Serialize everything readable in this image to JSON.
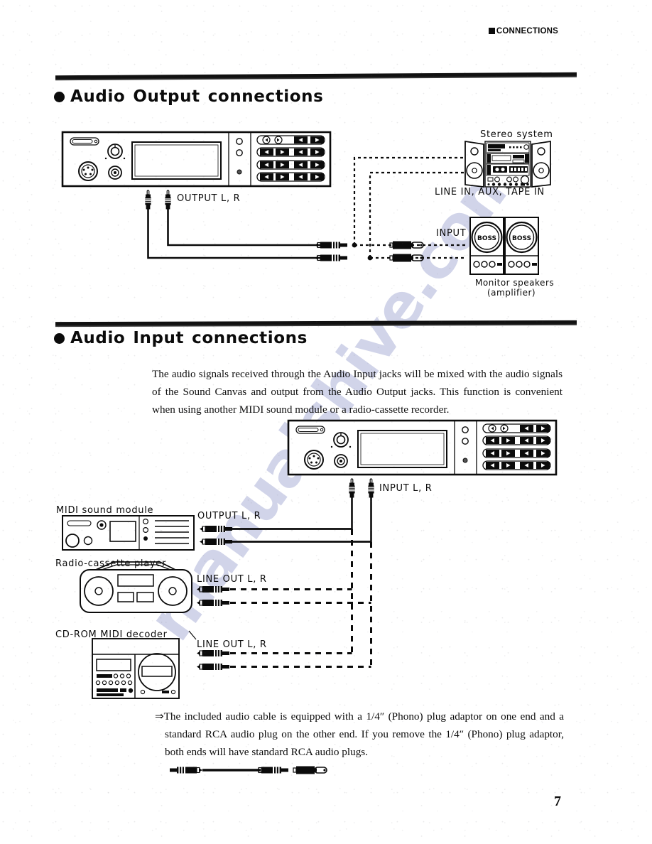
{
  "page": {
    "running_head": "CONNECTIONS",
    "page_number": "7",
    "watermark": "manualshive.com"
  },
  "sections": [
    {
      "id": "audio-output",
      "bullet": "●",
      "words": [
        "Audio",
        "Output",
        "connections"
      ],
      "title": "Audio Output connections"
    },
    {
      "id": "audio-input",
      "bullet": "●",
      "words": [
        "Audio",
        "Input",
        "connections"
      ],
      "title": "Audio Input connections"
    }
  ],
  "intro_paragraph": "The audio signals received through the Audio Input jacks will be mixed with the audio signals of the Sound Canvas and output from the Audio Output jacks. This function is convenient when using another MIDI sound module or a radio-cassette recorder.",
  "footnote": {
    "arrow": "⇒",
    "text": "The included audio cable is equipped with a 1/4″ (Phono) plug adaptor on one end and a standard RCA audio plug on the other end. If you remove the 1/4″ (Phono) plug adaptor, both ends will have standard RCA audio plugs."
  },
  "output_diagram": {
    "device_label": "",
    "output_jacks_label": "OUTPUT L, R",
    "stereo_system_label": "Stereo system",
    "stereo_inputs_label": "LINE IN, AUX, TAPE IN",
    "speaker_input_label": "INPUT",
    "speaker_brand": "BOSS",
    "monitor_caption_line1": "Monitor speakers",
    "monitor_caption_line2": "(amplifier)"
  },
  "input_diagram": {
    "input_jacks_label": "INPUT L, R",
    "sources": [
      {
        "name": "MIDI sound module",
        "jack_label": "OUTPUT L, R"
      },
      {
        "name": "Radio-cassette player",
        "jack_label": "LINE OUT L, R"
      },
      {
        "name": "CD-ROM MIDI decoder",
        "jack_label": "LINE OUT L, R"
      }
    ]
  },
  "colors": {
    "ink": "#0b0b0b",
    "paper": "#ffffff",
    "watermark": "#6870b6"
  }
}
